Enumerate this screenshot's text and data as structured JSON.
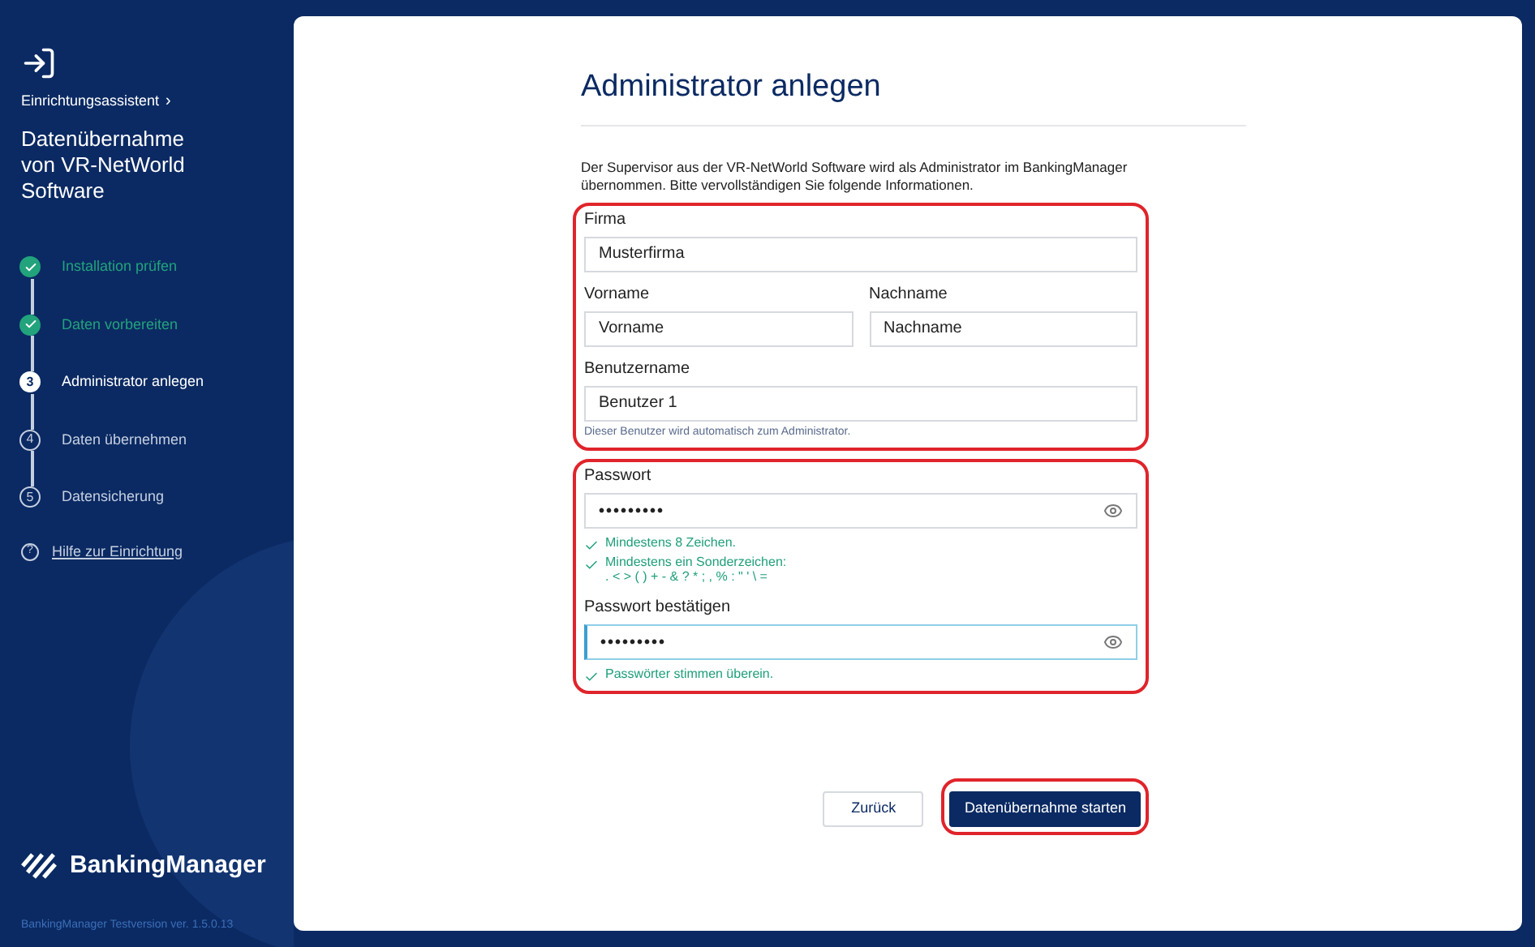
{
  "sidebar": {
    "breadcrumb": "Einrichtungsassistent",
    "breadcrumb_arrow": "›",
    "title": "Datenübernahme von VR-NetWorld Software",
    "steps": [
      {
        "label": "Installation prüfen",
        "completed": true,
        "selected": false
      },
      {
        "label": "Daten vorbereiten",
        "completed": true,
        "selected": false
      },
      {
        "number": "3",
        "label": "Administrator anlegen",
        "completed": false,
        "selected": true
      },
      {
        "number": "4",
        "label": "Daten übernehmen",
        "completed": false,
        "selected": false
      },
      {
        "number": "5",
        "label": "Datensicherung",
        "completed": false,
        "selected": false
      }
    ],
    "help_icon": "?",
    "help_link": "Hilfe zur Einrichtung",
    "brand": "BankingManager",
    "version": "BankingManager Testversion ver. 1.5.0.13"
  },
  "main": {
    "title": "Administrator anlegen",
    "description": "Der Supervisor aus der VR-NetWorld Software wird als Administrator im BankingManager übernommen. Bitte vervollständigen Sie folgende Informationen.",
    "user_group": {
      "highlighted": true,
      "company": {
        "label": "Firma",
        "value": "Musterfirma"
      },
      "first_name": {
        "label": "Vorname",
        "value": "Vorname"
      },
      "last_name": {
        "label": "Nachname",
        "value": "Nachname"
      },
      "username": {
        "label": "Benutzername",
        "value": "Benutzer 1",
        "hint": "Dieser Benutzer wird automatisch zum Administrator."
      }
    },
    "password_group": {
      "highlighted": true,
      "password": {
        "label": "Passwort",
        "value": "•••••••••",
        "focused": false
      },
      "rules": [
        {
          "text": "Mindestens 8 Zeichen.",
          "met": true
        },
        {
          "text": "Mindestens ein Sonderzeichen:",
          "detail": ". < > ( ) + - & ? * ; , % : \" ' \\ =",
          "met": true
        }
      ],
      "confirm": {
        "label": "Passwort bestätigen",
        "value": "•••••••••",
        "focused": true
      },
      "match": {
        "text": "Passwörter stimmen überein.",
        "met": true
      }
    },
    "buttons": [
      {
        "label": "Zurück",
        "kind": "secondary",
        "highlighted": false
      },
      {
        "label": "Datenübernahme starten",
        "kind": "primary",
        "highlighted": true
      }
    ]
  }
}
